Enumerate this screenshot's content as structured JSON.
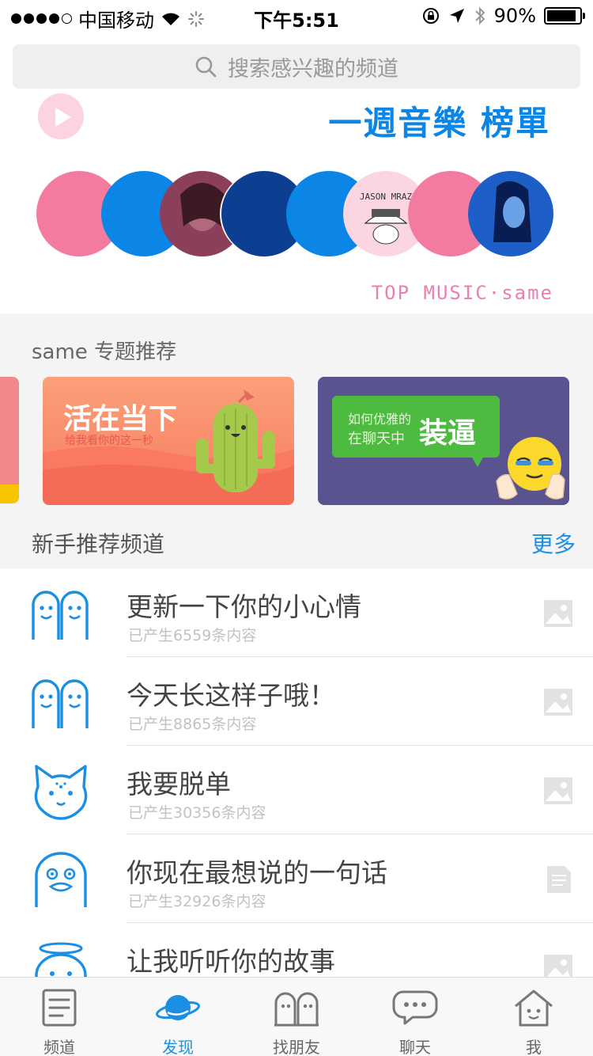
{
  "status_bar": {
    "carrier": "中国移动",
    "time": "下午5:51",
    "battery": "90%",
    "battery_level": 0.9
  },
  "search": {
    "placeholder": "搜索感兴趣的频道"
  },
  "banner": {
    "title": "一週音樂 榜單",
    "subtitle": "TOP MUSIC·same",
    "jason_mraz_text": "JASON MRAZ"
  },
  "topics": {
    "section_title": "same 专题推荐",
    "cards": [
      {
        "title": "活在当下",
        "subtitle": "给我看你的这一秒"
      },
      {
        "line1": "如何优雅的",
        "line2": "在聊天中",
        "highlight": "装逼"
      }
    ]
  },
  "new_channels": {
    "section_title": "新手推荐频道",
    "more_label": "更多",
    "items": [
      {
        "name": "更新一下你的小心情",
        "count": "已产生6559条内容",
        "icon": "ghost-pair-icon",
        "thumb": "image-thumbnail-icon"
      },
      {
        "name": "今天长这样子哦！",
        "count": "已产生8865条内容",
        "icon": "ghost-pair-icon",
        "thumb": "image-thumbnail-icon"
      },
      {
        "name": "我要脱单",
        "count": "已产生30356条内容",
        "icon": "cat-face-icon",
        "thumb": "image-thumbnail-icon"
      },
      {
        "name": "你现在最想说的一句话",
        "count": "已产生32926条内容",
        "icon": "duck-face-icon",
        "thumb": "document-icon"
      },
      {
        "name": "让我听听你的故事",
        "count": "",
        "icon": "angel-face-icon",
        "thumb": "image-thumbnail-icon"
      }
    ]
  },
  "tabbar": {
    "items": [
      {
        "label": "频道",
        "icon": "channel-list-icon"
      },
      {
        "label": "发现",
        "icon": "planet-icon"
      },
      {
        "label": "找朋友",
        "icon": "find-friends-icon"
      },
      {
        "label": "聊天",
        "icon": "chat-bubble-icon"
      },
      {
        "label": "我",
        "icon": "home-face-icon"
      }
    ],
    "active_index": 1
  },
  "colors": {
    "accent": "#1a8fe3",
    "banner_blue": "#0b86e6",
    "banner_pink": "#ea7fb2",
    "card_green": "#4cbb3f",
    "card_purple": "#59538f"
  }
}
